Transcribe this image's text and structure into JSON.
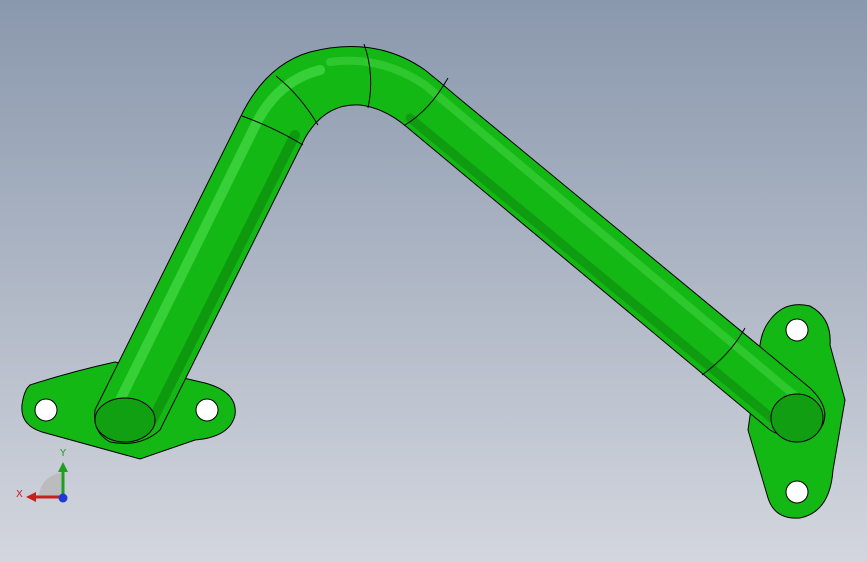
{
  "viewport": {
    "background_top": "#8a98ad",
    "background_bottom": "#d3d6de"
  },
  "part": {
    "color": "#14b814",
    "edge_color": "#000000"
  },
  "triad": {
    "x_label": "X",
    "y_label": "Y",
    "x_color": "#c81e1e",
    "y_color": "#1ea01e",
    "z_color": "#1e3cd2"
  }
}
